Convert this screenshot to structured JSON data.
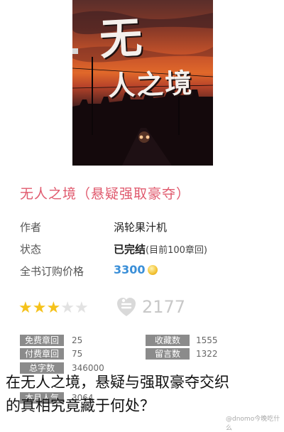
{
  "cover": {
    "title_line1": "无",
    "title_line2": "人之境"
  },
  "book_title": "无人之境（悬疑强取豪夺）",
  "info": {
    "author_label": "作者",
    "author_value": "涡轮果汁机",
    "status_label": "状态",
    "status_value": "已完结",
    "status_sub": "(目前100章回)",
    "price_label": "全书订购价格",
    "price_value": "3300"
  },
  "rating": {
    "stars_filled": 3,
    "stars_total": 5,
    "count": "2177"
  },
  "stats": {
    "free_label": "免费章回",
    "free_value": "25",
    "paid_label": "付费章回",
    "paid_value": "75",
    "words_label": "总字数",
    "words_value": "346000",
    "month_label": "本月人气",
    "month_value": "3064",
    "fav_label": "收藏数",
    "fav_value": "1555",
    "msg_label": "留言数",
    "msg_value": "1322"
  },
  "caption": {
    "line1": "在无人之境，悬疑与强取豪夺交织",
    "line2": "的真相究竟藏于何处？"
  },
  "watermark": "@dnomo今晚吃什么",
  "colors": {
    "title_pink": "#e05a6e",
    "price_blue": "#3a8fd8",
    "star_gold": "#f5c21b",
    "tag_gray": "#8b8b8b"
  }
}
